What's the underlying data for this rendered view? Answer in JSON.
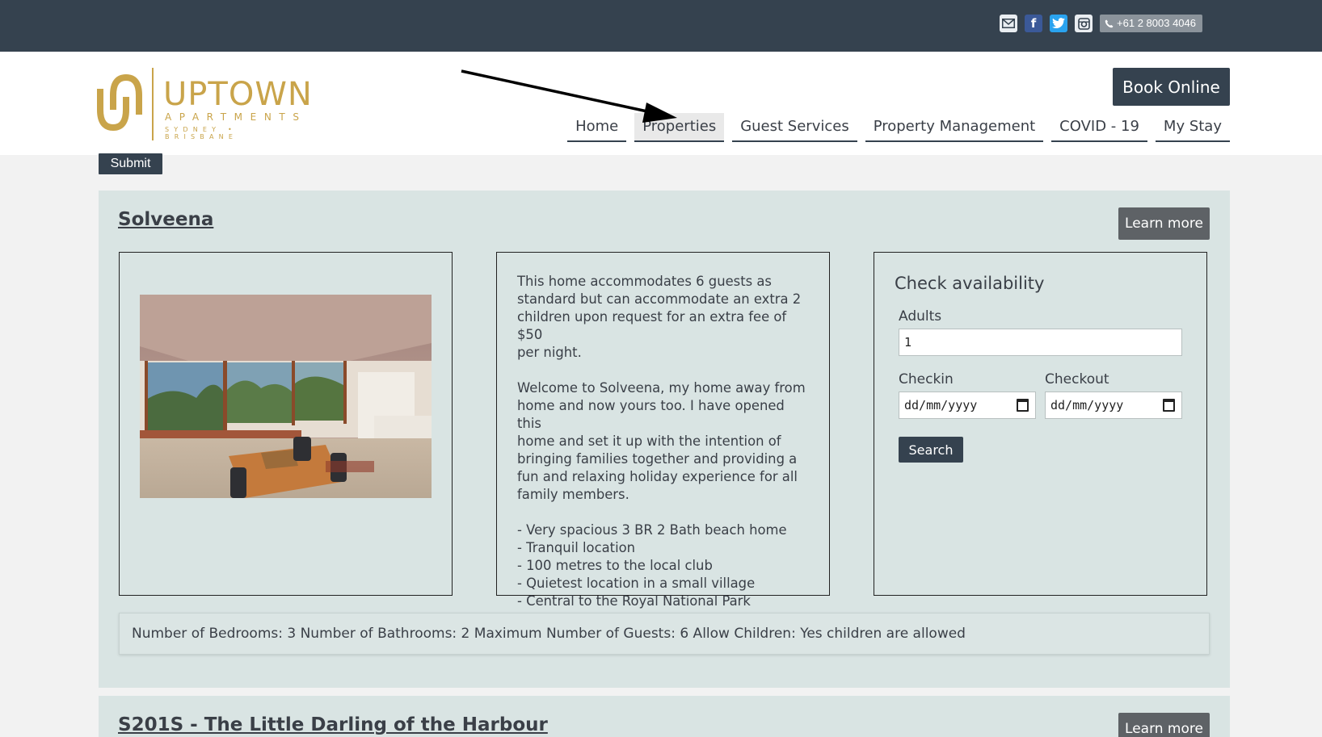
{
  "topbar": {
    "phone": "+61 2 8003 4046",
    "icons": [
      "mail-icon",
      "facebook-icon",
      "twitter-icon",
      "instagram-icon",
      "phone-icon"
    ]
  },
  "logo": {
    "word": "UPTOWN",
    "sub": "APARTMENTS",
    "city": "SYDNEY • BRISBANE"
  },
  "header": {
    "book_label": "Book Online"
  },
  "nav": {
    "items": [
      {
        "label": "Home"
      },
      {
        "label": "Properties"
      },
      {
        "label": "Guest Services"
      },
      {
        "label": "Property Management"
      },
      {
        "label": "COVID - 19"
      },
      {
        "label": "My Stay"
      }
    ],
    "active": "Properties"
  },
  "filter": {
    "submit_label": "Submit"
  },
  "properties": [
    {
      "title": "Solveena",
      "learn_more": "Learn more",
      "description": [
        "This home accommodates 6 guests as\nstandard but can accommodate an extra 2\nchildren upon request for an extra fee of $50\nper night.",
        "Welcome to Solveena, my home away from\nhome and now yours too. I have opened this\nhome and set it up with the intention of\nbringing families together and providing a\nfun and relaxing holiday experience for all\nfamily members.",
        "- Very spacious 3 BR 2 Bath beach home\n- Tranquil location\n- 100 metres to the local club\n- Quietest location in a small village\n- Central to the Royal National Park"
      ],
      "availability": {
        "title": "Check availability",
        "adults_label": "Adults",
        "adults_value": "1",
        "checkin_label": "Checkin",
        "checkin_value": "dd/mm/yyyy",
        "checkout_label": "Checkout",
        "checkout_value": "dd/mm/yyyy",
        "search_label": "Search"
      },
      "specs": "Number of Bedrooms: 3 Number of Bathrooms: 2 Maximum Number of Guests: 6 Allow Children: Yes children are allowed"
    },
    {
      "title": "S201S - The Little Darling of the Harbour",
      "learn_more": "Learn more"
    }
  ],
  "colors": {
    "topbar": "#35424f",
    "brand_gold": "#c9a44a",
    "card_bg": "#d9e4e3",
    "button_dark": "#35424f",
    "button_grey": "#5e6266"
  }
}
